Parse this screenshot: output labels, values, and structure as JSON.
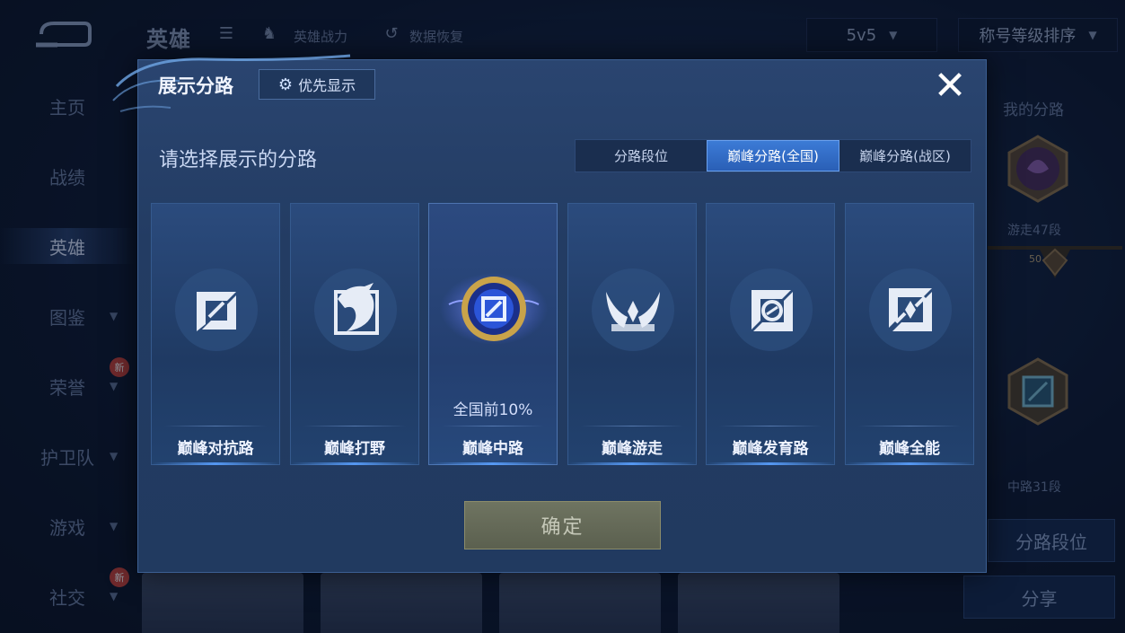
{
  "background": {
    "header": {
      "title": "英雄",
      "link_power": "英雄战力",
      "link_restore": "数据恢复",
      "mode_select": "5v5",
      "sort_select": "称号等级排序"
    },
    "side_nav": [
      {
        "label": "主页"
      },
      {
        "label": "战绩"
      },
      {
        "label": "英雄"
      },
      {
        "label": "图鉴"
      },
      {
        "label": "荣誉",
        "badge": "新"
      },
      {
        "label": "护卫队"
      },
      {
        "label": "游戏"
      },
      {
        "label": "社交",
        "badge": "新"
      }
    ],
    "right_panel": {
      "title": "我的分路",
      "rank_1_label": "游走47段",
      "level_badge": "50",
      "rank_2_label": "中路31段",
      "lane_rank_button": "分路段位",
      "share_button": "分享"
    }
  },
  "modal": {
    "title": "展示分路",
    "priority_button": "优先显示",
    "close_icon": "close-icon",
    "subtitle": "请选择展示的分路",
    "tabs": [
      {
        "label": "分路段位",
        "active": false
      },
      {
        "label": "巅峰分路(全国)",
        "active": true
      },
      {
        "label": "巅峰分路(战区)",
        "active": false
      }
    ],
    "lanes": [
      {
        "label": "巅峰对抗路",
        "icon": "clash-lane-icon",
        "rank": ""
      },
      {
        "label": "巅峰打野",
        "icon": "jungle-icon",
        "rank": ""
      },
      {
        "label": "巅峰中路",
        "icon": "mid-lane-icon",
        "rank": "全国前10%"
      },
      {
        "label": "巅峰游走",
        "icon": "roam-icon",
        "rank": ""
      },
      {
        "label": "巅峰发育路",
        "icon": "farm-lane-icon",
        "rank": ""
      },
      {
        "label": "巅峰全能",
        "icon": "all-round-icon",
        "rank": ""
      }
    ],
    "confirm_button": "确定"
  },
  "colors": {
    "active_tab": "#2a5fb6",
    "modal_bg": "#233c63",
    "confirm_bg": "#5b604f"
  }
}
